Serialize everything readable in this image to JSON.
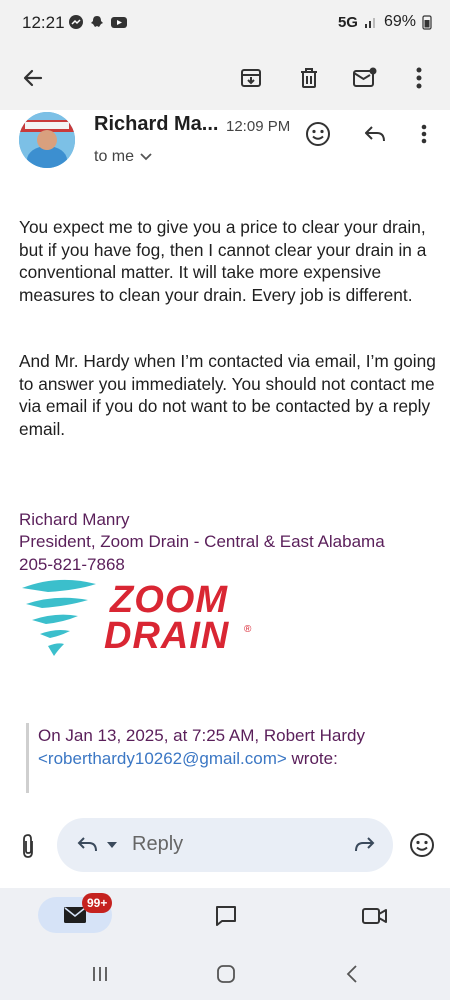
{
  "status_bar": {
    "time": "12:21",
    "network": "5G",
    "battery": "69%"
  },
  "email": {
    "sender_name": "Richard Ma...",
    "time": "12:09 PM",
    "recipient": "to me",
    "paragraphs": [
      "You expect me to give you a price to clear your drain, but if you have fog, then I cannot clear your drain in a conventional matter. It will take more expensive measures to clean your drain. Every job is different.",
      "And Mr. Hardy when I’m contacted via email, I’m going to answer you immediately. You should not contact me via email if you do not want to be contacted by a reply email."
    ],
    "signature": {
      "name": "Richard Manry",
      "title": "President, Zoom Drain - Central & East Alabama",
      "phone": "205-821-7868"
    },
    "logo": {
      "line1": "ZOOM",
      "line2": "DRAIN"
    },
    "quote": {
      "intro": "On Jan 13, 2025, at 7:25 AM, Robert Hardy",
      "email": "<roberthardy10262@gmail.com>",
      "suffix": " wrote:"
    }
  },
  "reply_bar": {
    "reply_label": "Reply"
  },
  "bottom_nav": {
    "mail_badge": "99+"
  },
  "icons": {
    "back": "arrow-left-icon",
    "archive": "archive-icon",
    "delete": "trash-icon",
    "unread": "mark-unread-icon",
    "more": "more-vert-icon",
    "emoji": "emoji-icon",
    "reply": "reply-icon",
    "attach": "paperclip-icon",
    "forward": "forward-icon",
    "mail": "mail-icon",
    "chat": "chat-icon",
    "meet": "video-icon"
  },
  "colors": {
    "signature": "#5a1f5a",
    "link": "#3b77c4",
    "badge": "#c5221f",
    "logo_red": "#d92633",
    "logo_cyan": "#3bbfcc"
  }
}
